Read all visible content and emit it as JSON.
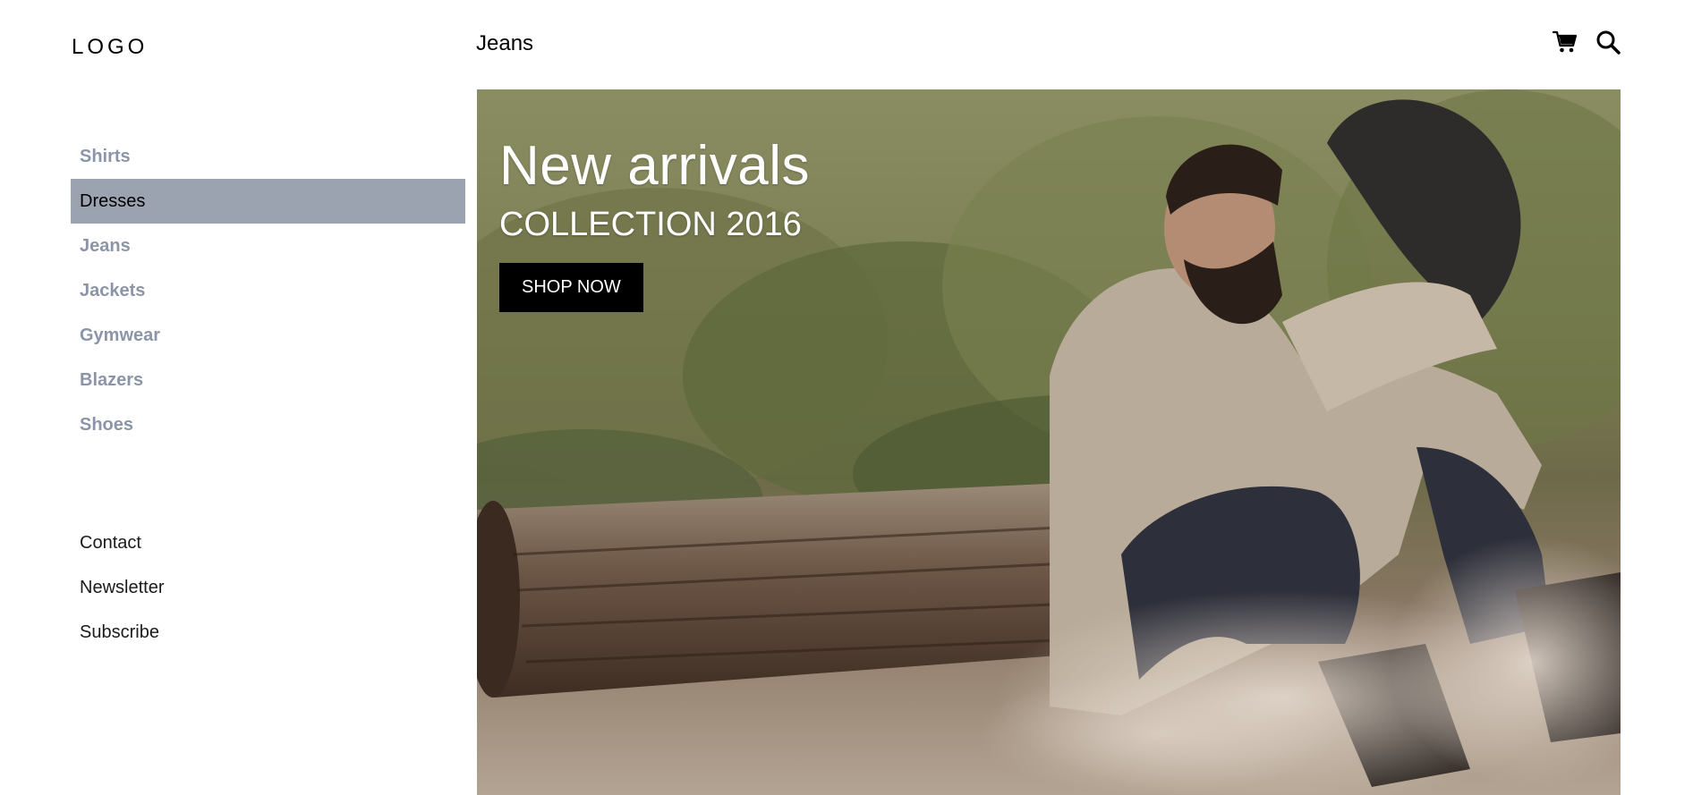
{
  "brand": {
    "logo": "LOGO"
  },
  "header": {
    "title": "Jeans",
    "icons": [
      "cart-icon",
      "search-icon"
    ]
  },
  "sidebar": {
    "categories": [
      {
        "label": "Shirts",
        "active": false
      },
      {
        "label": "Dresses",
        "active": true
      },
      {
        "label": "Jeans",
        "active": false
      },
      {
        "label": "Jackets",
        "active": false
      },
      {
        "label": "Gymwear",
        "active": false
      },
      {
        "label": "Blazers",
        "active": false
      },
      {
        "label": "Shoes",
        "active": false
      }
    ],
    "links": [
      {
        "label": "Contact"
      },
      {
        "label": "Newsletter"
      },
      {
        "label": "Subscribe"
      }
    ]
  },
  "hero": {
    "heading": "New arrivals",
    "subheading": "COLLECTION 2016",
    "cta_label": "SHOP NOW",
    "image": "man-sitting-on-log-in-desert-photo"
  },
  "colors": {
    "active_bg": "#9ca3b0",
    "inactive_text": "#8c95a7",
    "button_bg": "#000000",
    "button_text": "#ffffff"
  }
}
